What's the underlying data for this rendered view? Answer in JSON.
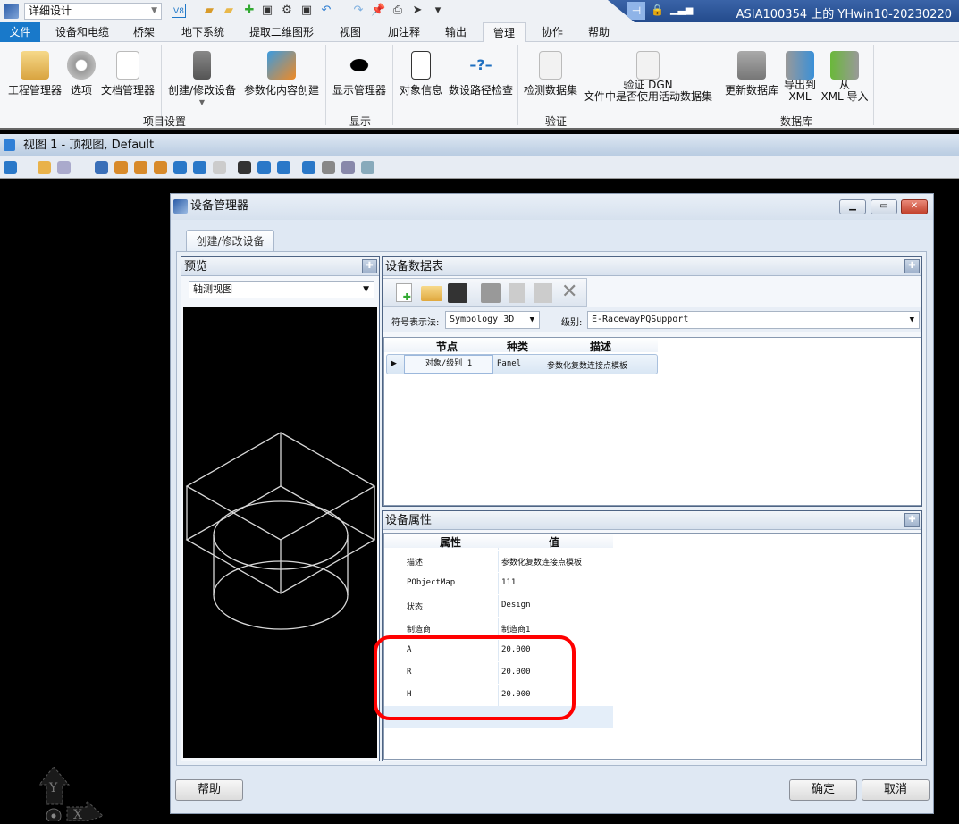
{
  "window": {
    "workflow": "详细设计",
    "title": "ASIA100354 上的 YHwin10-20230220"
  },
  "ribbon_tabs": [
    "文件",
    "设备和电缆",
    "桥架",
    "地下系统",
    "提取二维图形",
    "视图",
    "加注释",
    "输出",
    "管理",
    "协作",
    "帮助"
  ],
  "active_tab": "管理",
  "ribbon": {
    "buttons": [
      "工程管理器",
      "选项",
      "文档管理器",
      "创建/修改设备",
      "参数化内容创建",
      "显示管理器",
      "对象信息",
      "数设路径检查",
      "检测数据集",
      "验证 DGN\n文件中是否使用活动数据集",
      "更新数据库",
      "导出到\nXML",
      "从\nXML 导入"
    ],
    "groups": [
      "项目设置",
      "显示",
      "验证",
      "数据库"
    ]
  },
  "view": {
    "title": "视图 1 - 顶视图, Default"
  },
  "axis": {
    "y": "Y",
    "x": "X"
  },
  "dialog": {
    "title": "设备管理器",
    "tab": "创建/修改设备",
    "preview": {
      "header": "预览",
      "view_mode": "轴测视图"
    },
    "datatable": {
      "header": "设备数据表",
      "symbology_label": "符号表示法:",
      "symbology": "Symbology_3D",
      "level_label": "级别:",
      "level": "E-RacewayPQSupport",
      "columns": [
        "节点",
        "种类",
        "描述"
      ],
      "rows": [
        {
          "node": "对象/级别 1",
          "type": "Panel",
          "desc": "参数化复数连接点模板"
        }
      ]
    },
    "properties": {
      "header": "设备属性",
      "columns": [
        "属性",
        "值"
      ],
      "rows": [
        {
          "name": "描述",
          "value": "参数化复数连接点模板"
        },
        {
          "name": "PObjectMap",
          "value": "111"
        },
        {
          "name": "状态",
          "value": "Design"
        },
        {
          "name": "制造商",
          "value": "制造商1"
        },
        {
          "name": "A",
          "value": "20.000"
        },
        {
          "name": "R",
          "value": "20.000"
        },
        {
          "name": "H",
          "value": "20.000"
        }
      ]
    },
    "buttons": {
      "help": "帮助",
      "ok": "确定",
      "cancel": "取消"
    }
  },
  "colors": {
    "file_tab": "#1979ca",
    "highlight": "#ff0000",
    "title_blue": "#2a5597"
  }
}
